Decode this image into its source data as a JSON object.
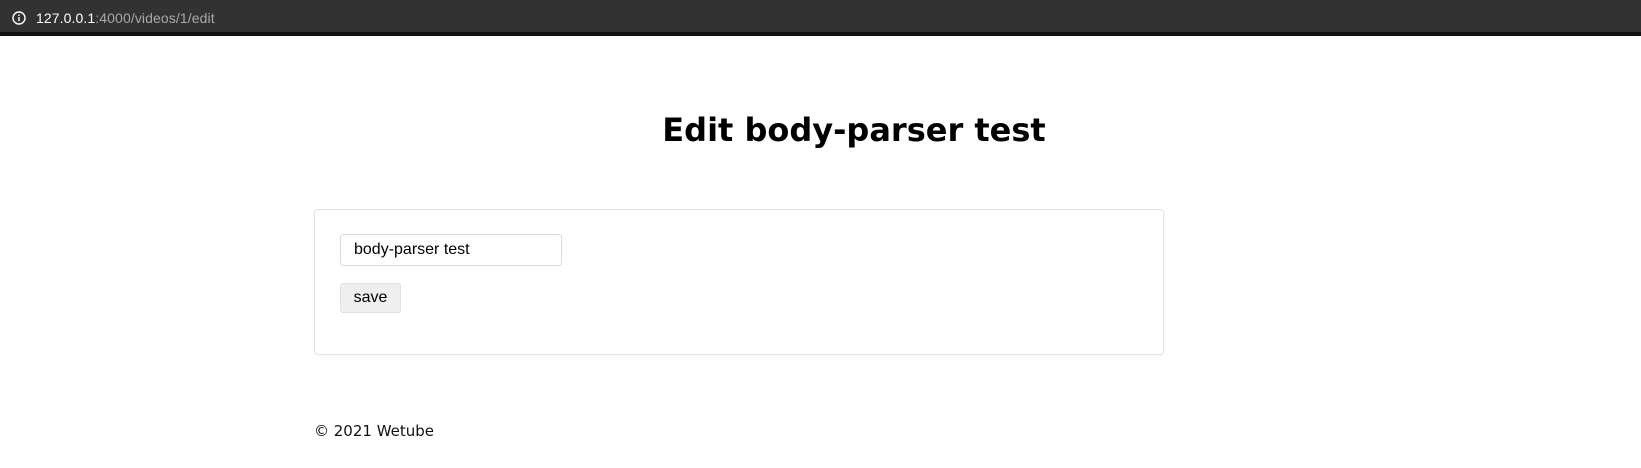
{
  "browser": {
    "url_host": "127.0.0.1",
    "url_path": ":4000/videos/1/edit",
    "info_icon": "info-icon"
  },
  "page": {
    "title": "Edit body-parser test"
  },
  "form": {
    "title_value": "body-parser test",
    "save_label": "save"
  },
  "footer": {
    "text": "© 2021 Wetube"
  }
}
